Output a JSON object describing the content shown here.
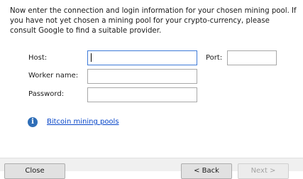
{
  "intro": "Now enter the connection and login information for your chosen mining pool. If you have not yet chosen a mining pool for your crypto-currency, please consult Google to find a suitable provider.",
  "form": {
    "host_label": "Host:",
    "host_value": "",
    "port_label": "Port:",
    "port_value": "",
    "worker_label": "Worker name:",
    "worker_value": "",
    "password_label": "Password:",
    "password_value": ""
  },
  "info": {
    "icon": "info-icon",
    "icon_glyph": "i",
    "link_label": "Bitcoin mining pools"
  },
  "footer": {
    "close_label": "Close",
    "back_label": "< Back",
    "next_label": "Next >"
  }
}
